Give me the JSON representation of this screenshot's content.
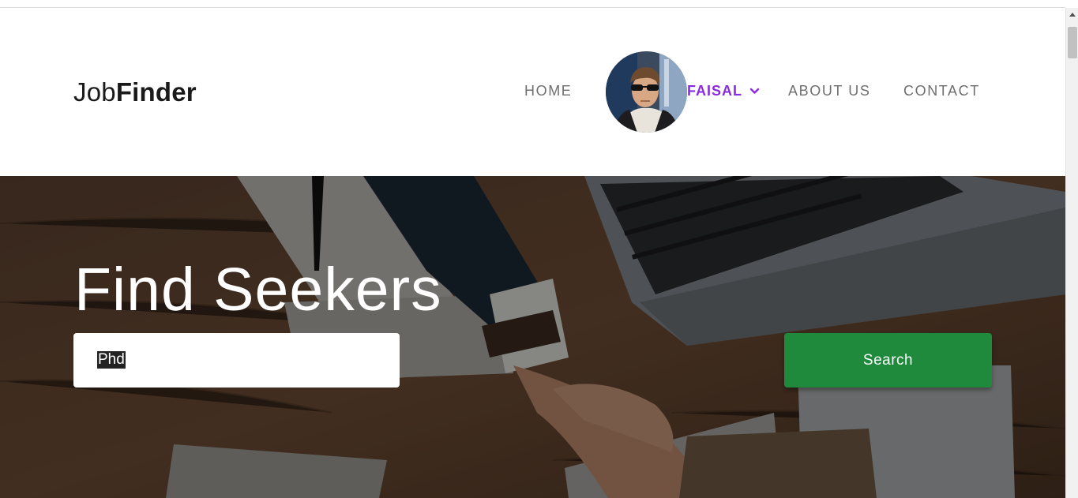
{
  "brand": {
    "light": "Job",
    "bold": "Finder"
  },
  "nav": {
    "home": "HOME",
    "user": {
      "name": "FAISAL",
      "avatar_icon": "user-avatar",
      "dropdown_icon": "chevron-down-icon"
    },
    "about": "ABOUT US",
    "contact": "CONTACT"
  },
  "hero": {
    "title": "Find Seekers",
    "search": {
      "value": "Phd"
    },
    "search_button": "Search"
  },
  "colors": {
    "accent_user": "#8a2be2",
    "button_green": "#1f8a3b",
    "nav_text": "#6f6f6f"
  }
}
